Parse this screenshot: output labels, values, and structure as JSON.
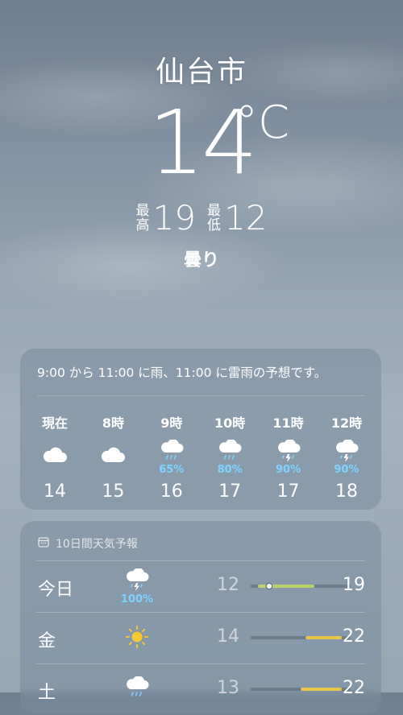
{
  "location": {
    "city": "仙台市"
  },
  "current": {
    "temperature": "14",
    "unit": "°C",
    "high_label": [
      "最",
      "高"
    ],
    "high": "19",
    "low_label": [
      "最",
      "低"
    ],
    "low": "12",
    "condition": "曇り"
  },
  "hourly": {
    "summary": "9:00 から 11:00 に雨、11:00 に雷雨の予想です。",
    "items": [
      {
        "time": "現在",
        "icon": "cloud-icon",
        "pop": "",
        "temp": "14"
      },
      {
        "time": "8時",
        "icon": "cloud-icon",
        "pop": "",
        "temp": "15"
      },
      {
        "time": "9時",
        "icon": "cloud-rain-icon",
        "pop": "65%",
        "temp": "16"
      },
      {
        "time": "10時",
        "icon": "cloud-rain-icon",
        "pop": "80%",
        "temp": "17"
      },
      {
        "time": "11時",
        "icon": "cloud-thunderstorm-icon",
        "pop": "90%",
        "temp": "17"
      },
      {
        "time": "12時",
        "icon": "cloud-thunderstorm-icon",
        "pop": "90%",
        "temp": "18"
      }
    ]
  },
  "daily": {
    "title": "10日間天気予報",
    "title_icon": "calendar-icon",
    "range_min": 12,
    "range_max": 23,
    "items": [
      {
        "day": "今日",
        "icon": "cloud-thunderstorm-icon",
        "pop": "100%",
        "low": "12",
        "high": "19",
        "bar_from": 12.8,
        "bar_to": 19,
        "bar_color": "#b9d36a",
        "current_temp": 14
      },
      {
        "day": "金",
        "icon": "sun-icon",
        "pop": "",
        "low": "14",
        "high": "22",
        "bar_from": 18,
        "bar_to": 22,
        "bar_color": "#e6c54a",
        "current_temp": null
      },
      {
        "day": "土",
        "icon": "cloud-rain-icon",
        "pop": "",
        "low": "13",
        "high": "22",
        "bar_from": 17.5,
        "bar_to": 22,
        "bar_color": "#e6c54a",
        "current_temp": null
      }
    ]
  }
}
